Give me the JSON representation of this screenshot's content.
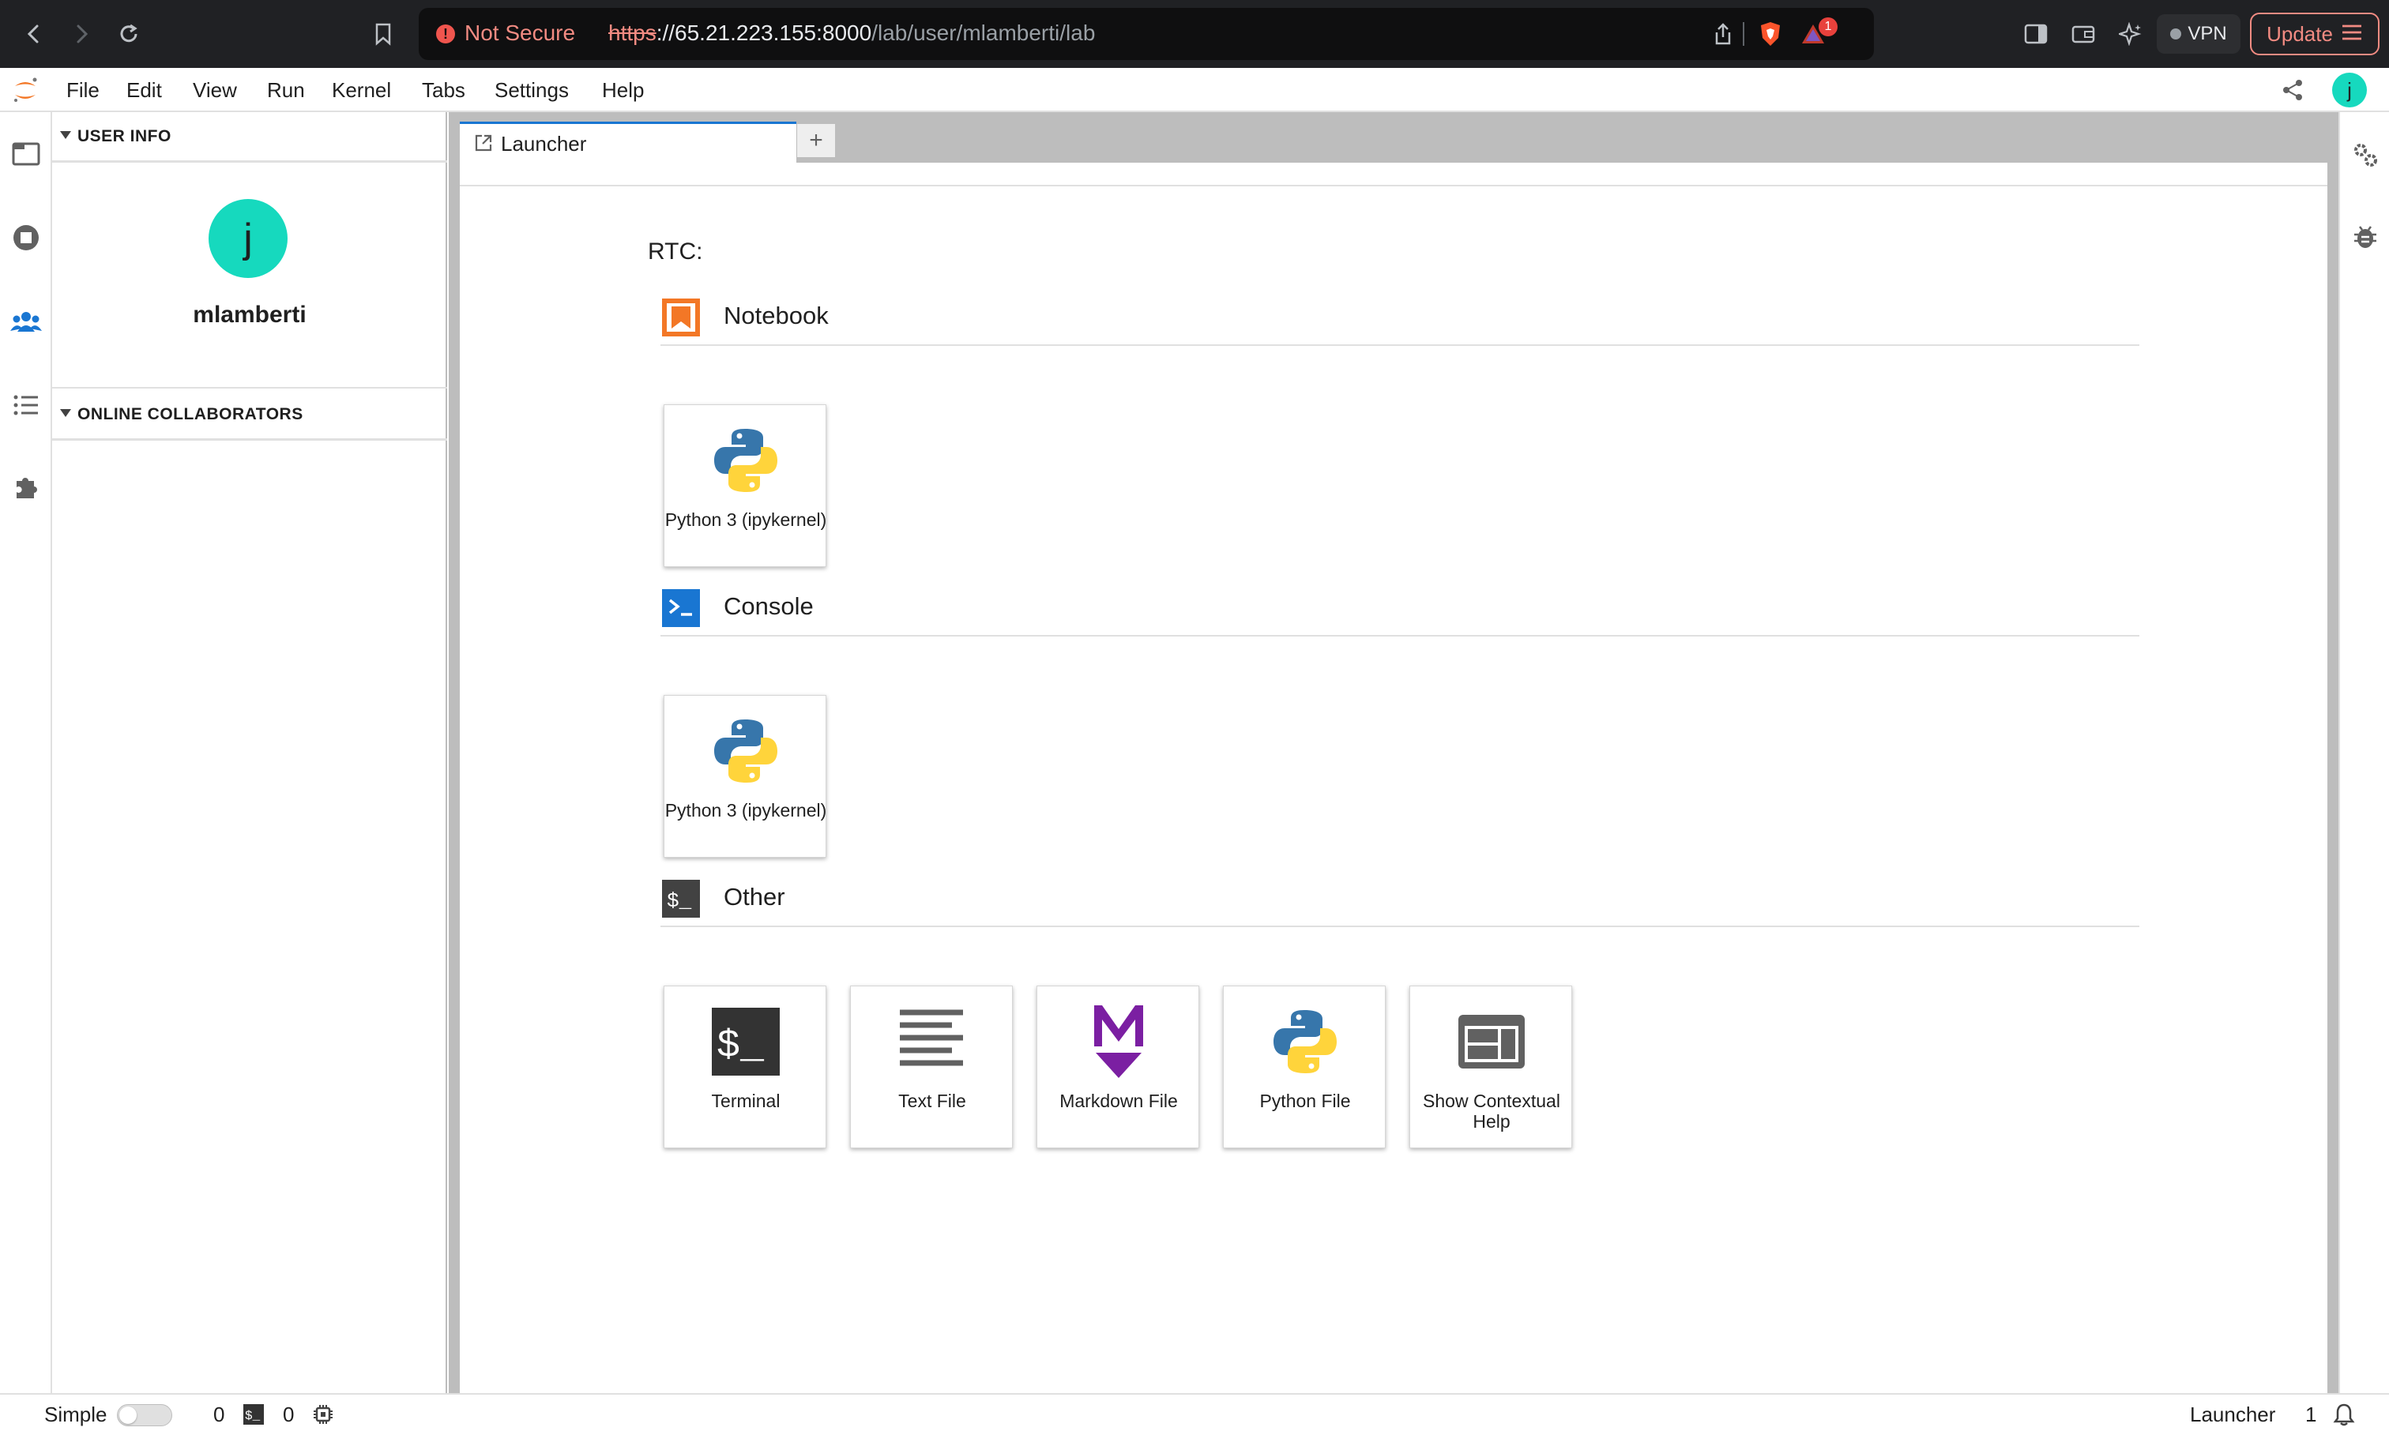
{
  "browser": {
    "security_label": "Not Secure",
    "url_protocol": "https",
    "url_host": "://65.21.223.155:8000",
    "url_path": "/lab/user/mlamberti/lab",
    "extension_badge": "1",
    "vpn_label": "VPN",
    "update_label": "Update"
  },
  "menubar": {
    "items": [
      "File",
      "Edit",
      "View",
      "Run",
      "Kernel",
      "Tabs",
      "Settings",
      "Help"
    ],
    "user_initial": "j"
  },
  "sidebar": {
    "user_info_title": "USER INFO",
    "avatar_initial": "j",
    "username": "mlamberti",
    "collaborators_title": "ONLINE COLLABORATORS"
  },
  "tabs": {
    "active_tab_label": "Launcher",
    "add_label": "+"
  },
  "launcher": {
    "rtc_label": "RTC:",
    "sections": [
      {
        "name": "Notebook",
        "cards": [
          {
            "label": "Python 3 (ipykernel)",
            "icon": "python-icon"
          }
        ]
      },
      {
        "name": "Console",
        "cards": [
          {
            "label": "Python 3 (ipykernel)",
            "icon": "python-icon"
          }
        ]
      },
      {
        "name": "Other",
        "cards": [
          {
            "label": "Terminal",
            "icon": "terminal-icon"
          },
          {
            "label": "Text File",
            "icon": "text-file-icon"
          },
          {
            "label": "Markdown File",
            "icon": "markdown-icon"
          },
          {
            "label": "Python File",
            "icon": "python-icon"
          },
          {
            "label": "Show Contextual Help",
            "icon": "contextual-help-icon"
          }
        ]
      }
    ]
  },
  "statusbar": {
    "mode_label": "Simple",
    "kernels_count": "0",
    "terminals_count": "0",
    "active_item": "Launcher",
    "notifications_count": "1"
  },
  "colors": {
    "avatar": "#16d9be",
    "notebook_orange": "#f37726",
    "console_blue": "#1976d2",
    "markdown_purple": "#7b1fa2",
    "tab_accent": "#1976d2",
    "warning_red": "#f28b82"
  }
}
